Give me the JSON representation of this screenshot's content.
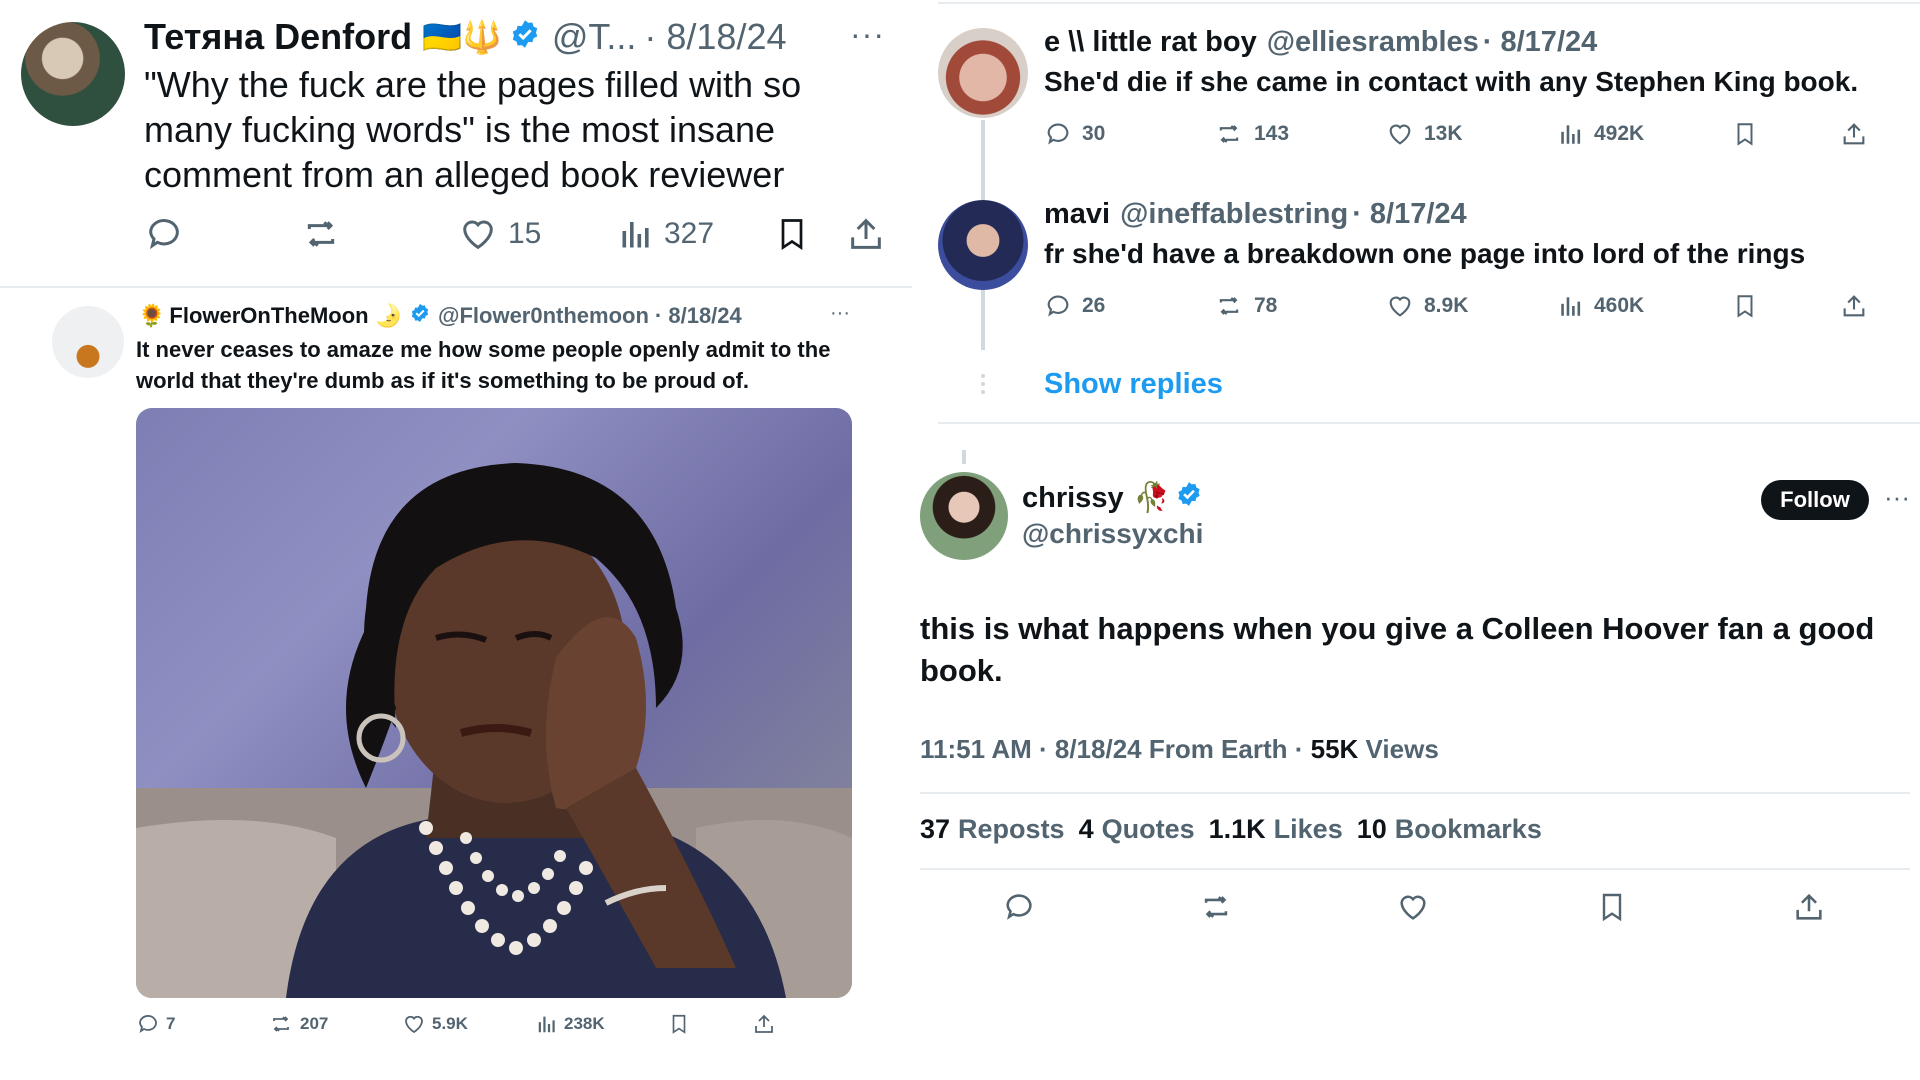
{
  "colors": {
    "text": "#0f1419",
    "muted": "#536471",
    "accent": "#1d9bf0",
    "divider": "#e6ecf0"
  },
  "tweet1": {
    "name": "Тетяна Denford",
    "flags": "🇺🇦🔱",
    "handle": "@T...",
    "date": "· 8/18/24",
    "more": "···",
    "text_lines": [
      "\"Why the fuck are the pages filled with so",
      "many fucking words\" is the most insane",
      "comment from an alleged book reviewer"
    ],
    "likes": "15",
    "views": "327"
  },
  "tweet2": {
    "emoji": "🌻",
    "name": "FlowerOnTheMoon",
    "moon": "🌛",
    "handle": "@Flower0nthemoon",
    "date": "· 8/18/24",
    "more": "···",
    "text_lines": [
      "It never ceases to amaze me how some people openly admit to the",
      "world that they're dumb as if it's something to be proud of."
    ],
    "replies": "7",
    "reposts": "207",
    "likes": "5.9K",
    "views": "238K"
  },
  "reply1": {
    "name": "e \\\\ little rat boy",
    "handle": "@elliesrambles",
    "date": "· 8/17/24",
    "text": "She'd die if she came in contact with any Stephen King book.",
    "replies": "30",
    "reposts": "143",
    "likes": "13K",
    "views": "492K"
  },
  "reply2": {
    "name": "mavi",
    "handle": "@ineffablestring",
    "date": "· 8/17/24",
    "text": "fr she'd have a breakdown one page into lord of the rings",
    "replies": "26",
    "reposts": "78",
    "likes": "8.9K",
    "views": "460K"
  },
  "show_replies": "Show replies",
  "main": {
    "name": "chrissy",
    "emoji": "🥀",
    "handle": "@chrissyxchi",
    "follow": "Follow",
    "more": "···",
    "text_lines": [
      "this is what happens when you give a Colleen Hoover fan a good",
      "book."
    ],
    "meta_time": "11:51 AM · 8/18/24 From Earth · ",
    "views_count": "55K",
    "views_label": " Views",
    "reposts_count": "37",
    "reposts_label": "Reposts",
    "quotes_count": "4",
    "quotes_label": "Quotes",
    "likes_count": "1.1K",
    "likes_label": "Likes",
    "bookmarks_count": "10",
    "bookmarks_label": "Bookmarks"
  }
}
